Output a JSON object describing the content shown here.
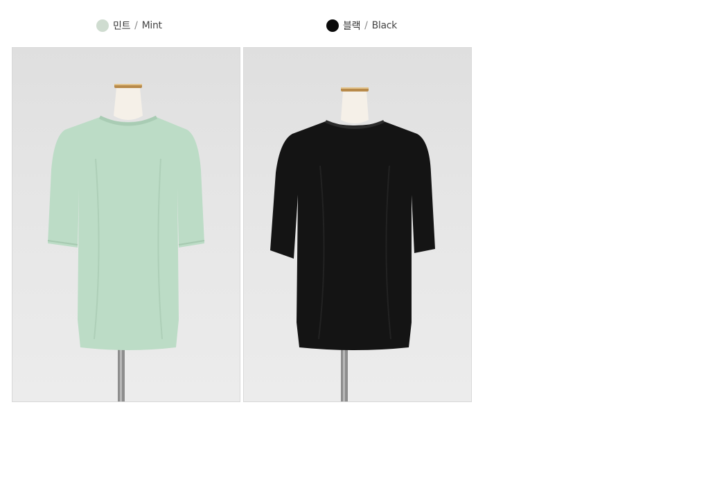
{
  "colors": [
    {
      "id": "mint",
      "swatch_color": "#cfdcd0",
      "name_ko": "민트",
      "separator": "/",
      "name_en": "Mint",
      "garment_color": "#bcdcc6",
      "image_alt": "Mint oversized t-shirt on mannequin"
    },
    {
      "id": "black",
      "swatch_color": "#0a0a0a",
      "name_ko": "블랙",
      "separator": "/",
      "name_en": "Black",
      "garment_color": "#141414",
      "image_alt": "Black oversized t-shirt on mannequin"
    }
  ]
}
